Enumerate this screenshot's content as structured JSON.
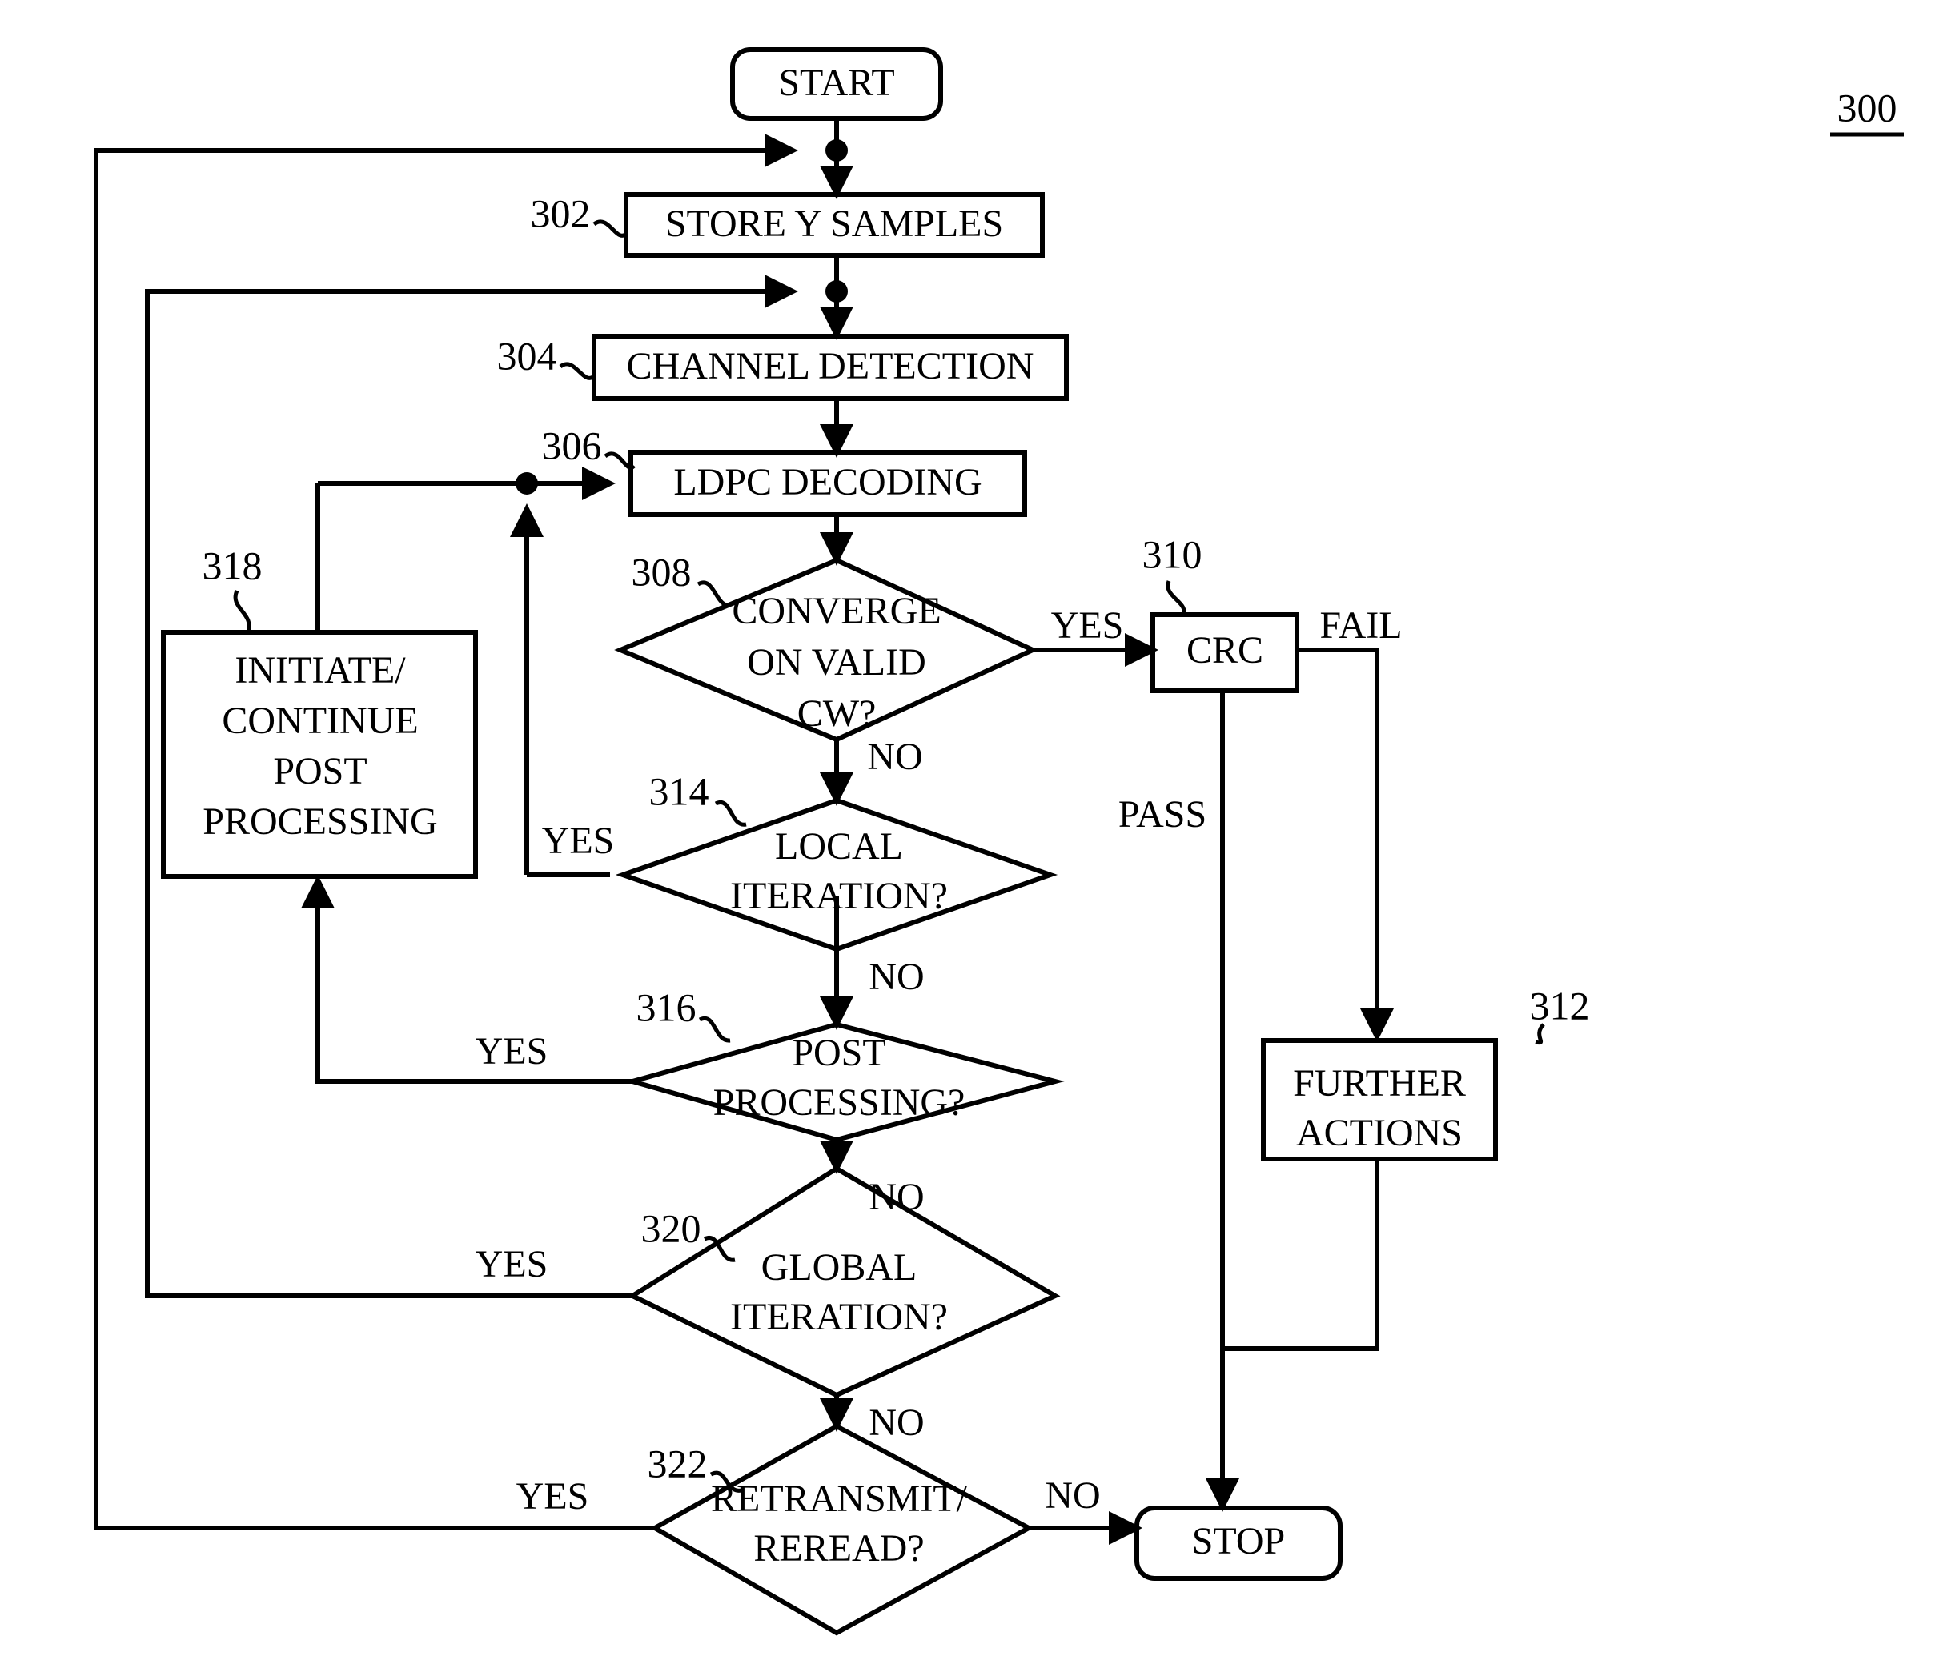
{
  "figure": {
    "number": "300",
    "underlined": true
  },
  "nodes": {
    "start": {
      "label": "START",
      "shape": "rounded-terminal"
    },
    "store_y": {
      "ref": "302",
      "label": "STORE Y SAMPLES",
      "shape": "process"
    },
    "channel_detection": {
      "ref": "304",
      "label": "CHANNEL DETECTION",
      "shape": "process"
    },
    "ldpc_decoding": {
      "ref": "306",
      "label": "LDPC DECODING",
      "shape": "process"
    },
    "converge": {
      "ref": "308",
      "label_lines": [
        "CONVERGE",
        "ON VALID",
        "CW?"
      ],
      "shape": "decision"
    },
    "crc": {
      "ref": "310",
      "label": "CRC",
      "shape": "process"
    },
    "further_actions": {
      "ref": "312",
      "label_lines": [
        "FURTHER",
        "ACTIONS"
      ],
      "shape": "process"
    },
    "local_iteration": {
      "ref": "314",
      "label_lines": [
        "LOCAL",
        "ITERATION?"
      ],
      "shape": "decision"
    },
    "post_processing_q": {
      "ref": "316",
      "label_lines": [
        "POST",
        "PROCESSING?"
      ],
      "shape": "decision"
    },
    "initiate_post": {
      "ref": "318",
      "label_lines": [
        "INITIATE/",
        "CONTINUE",
        "POST",
        "PROCESSING"
      ],
      "shape": "process"
    },
    "global_iteration": {
      "ref": "320",
      "label_lines": [
        "GLOBAL",
        "ITERATION?"
      ],
      "shape": "decision"
    },
    "retransmit": {
      "ref": "322",
      "label_lines": [
        "RETRANSMIT/",
        "REREAD?"
      ],
      "shape": "decision"
    },
    "stop": {
      "label": "STOP",
      "shape": "rounded-terminal"
    }
  },
  "edge_labels": {
    "converge_yes": "YES",
    "converge_no": "NO",
    "crc_fail": "FAIL",
    "crc_pass": "PASS",
    "local_yes": "YES",
    "local_no": "NO",
    "post_yes": "YES",
    "post_no": "NO",
    "global_yes": "YES",
    "global_no": "NO",
    "retransmit_yes": "YES",
    "retransmit_no": "NO"
  },
  "style": {
    "line_color": "#000000",
    "fill_color": "#ffffff",
    "stroke_width": 6
  }
}
